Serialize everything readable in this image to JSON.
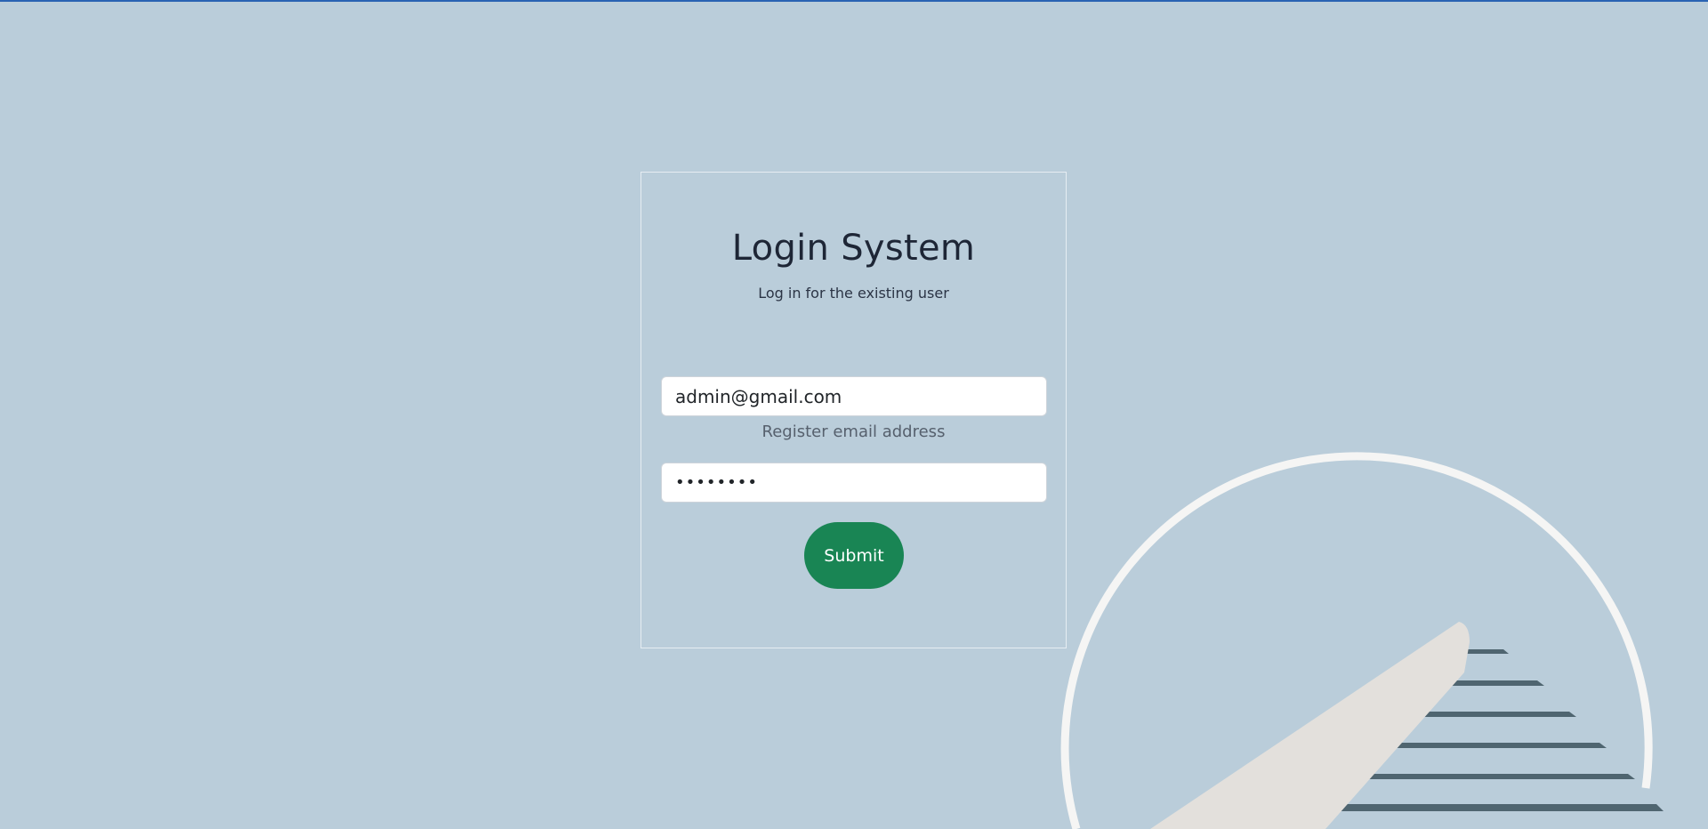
{
  "login": {
    "title": "Login System",
    "subtitle": "Log in for the existing user",
    "email_value": "admin@gmail.com",
    "email_help": "Register email address",
    "password_value": "12345678",
    "submit_label": "Submit"
  },
  "colors": {
    "background": "#bacdda",
    "top_border": "#2a63b3",
    "submit_button": "#198554",
    "card_border": "#e6edf2",
    "illustration_ring": "#f5f5f4",
    "illustration_hand": "#e3e0dc",
    "illustration_stripes": "#4f6570"
  },
  "illustration": {
    "icon": "speedometer-illustration"
  }
}
